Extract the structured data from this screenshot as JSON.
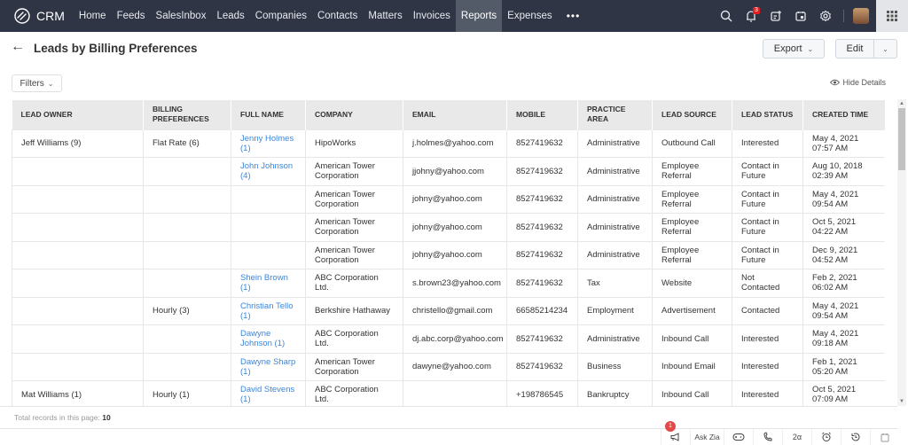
{
  "app": {
    "name": "CRM"
  },
  "nav": {
    "items": [
      "Home",
      "Feeds",
      "SalesInbox",
      "Leads",
      "Companies",
      "Contacts",
      "Matters",
      "Invoices",
      "Reports",
      "Expenses"
    ],
    "active": "Reports",
    "more": "•••"
  },
  "top_icons": {
    "notification_count": "3"
  },
  "header": {
    "title": "Leads by Billing Preferences",
    "export_label": "Export",
    "edit_label": "Edit"
  },
  "toolbar": {
    "filters_label": "Filters",
    "hide_details_label": "Hide Details"
  },
  "table": {
    "columns": [
      "LEAD OWNER",
      "BILLING PREFERENCES",
      "FULL NAME",
      "COMPANY",
      "EMAIL",
      "MOBILE",
      "PRACTICE AREA",
      "LEAD SOURCE",
      "LEAD STATUS",
      "CREATED TIME"
    ],
    "rows": [
      [
        "Jeff Williams (9)",
        "Flat Rate (6)",
        "Jenny Holmes (1)",
        "HipoWorks",
        "j.holmes@yahoo.com",
        "8527419632",
        "Administrative",
        "Outbound Call",
        "Interested",
        "May 4, 2021 07:57 AM"
      ],
      [
        "",
        "",
        "John Johnson (4)",
        "American Tower Corporation",
        "jjohny@yahoo.com",
        "8527419632",
        "Administrative",
        "Employee Referral",
        "Contact in Future",
        "Aug 10, 2018 02:39 AM"
      ],
      [
        "",
        "",
        "",
        "American Tower Corporation",
        "johny@yahoo.com",
        "8527419632",
        "Administrative",
        "Employee Referral",
        "Contact in Future",
        "May 4, 2021 09:54 AM"
      ],
      [
        "",
        "",
        "",
        "American Tower Corporation",
        "johny@yahoo.com",
        "8527419632",
        "Administrative",
        "Employee Referral",
        "Contact in Future",
        "Oct 5, 2021 04:22 AM"
      ],
      [
        "",
        "",
        "",
        "American Tower Corporation",
        "johny@yahoo.com",
        "8527419632",
        "Administrative",
        "Employee Referral",
        "Contact in Future",
        "Dec 9, 2021 04:52 AM"
      ],
      [
        "",
        "",
        "Shein Brown (1)",
        "ABC Corporation Ltd.",
        "s.brown23@yahoo.com",
        "8527419632",
        "Tax",
        "Website",
        "Not Contacted",
        "Feb 2, 2021 06:02 AM"
      ],
      [
        "",
        "Hourly (3)",
        "Christian Tello (1)",
        "Berkshire Hathaway",
        "christello@gmail.com",
        "66585214234",
        "Employment",
        "Advertisement",
        "Contacted",
        "May 4, 2021 09:54 AM"
      ],
      [
        "",
        "",
        "Dawyne Johnson (1)",
        "ABC Corporation Ltd.",
        "dj.abc.corp@yahoo.com",
        "8527419632",
        "Administrative",
        "Inbound Call",
        "Interested",
        "May 4, 2021 09:18 AM"
      ],
      [
        "",
        "",
        "Dawyne Sharp (1)",
        "American Tower Corporation",
        "dawyne@yahoo.com",
        "8527419632",
        "Business",
        "Inbound Email",
        "Interested",
        "Feb 1, 2021 05:20 AM"
      ],
      [
        "Mat Williams (1)",
        "Hourly (1)",
        "David Stevens (1)",
        "ABC Corporation Ltd.",
        "",
        "+198786545",
        "Bankruptcy",
        "Inbound Call",
        "Interested",
        "Oct 5, 2021 07:09 AM"
      ]
    ]
  },
  "footer": {
    "total_label": "Total records in this page:",
    "total_value": "10"
  },
  "bottombar": {
    "ask_zia_label": "Ask Zia",
    "announcement_count": "1"
  }
}
